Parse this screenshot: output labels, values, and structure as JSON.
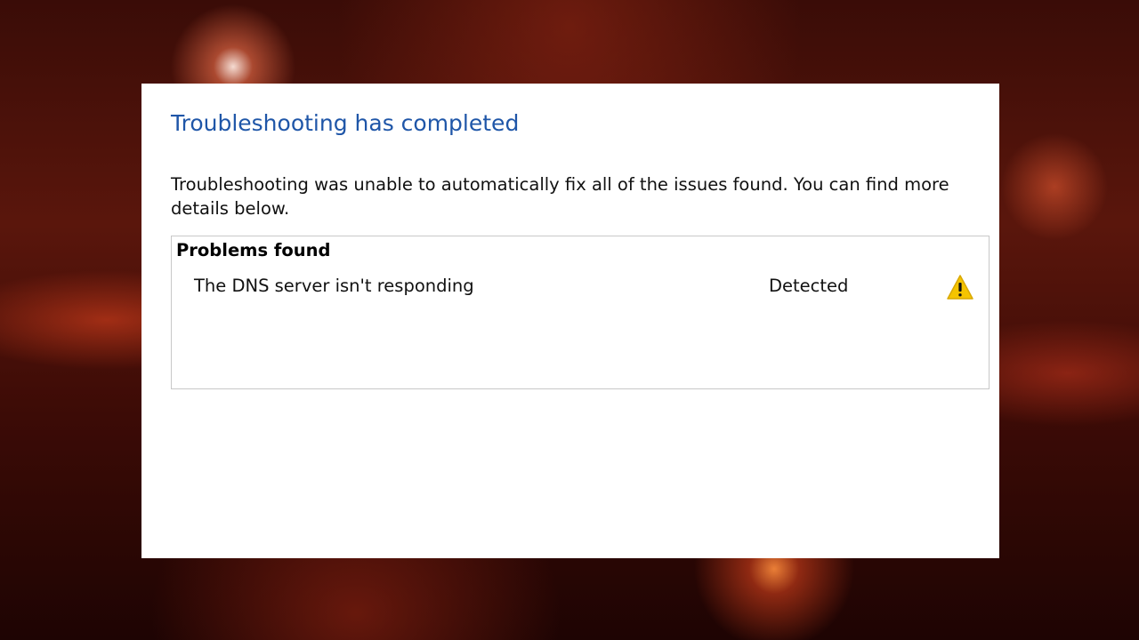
{
  "dialog": {
    "title": "Troubleshooting has completed",
    "description": "Troubleshooting was unable to automatically fix all of the issues found. You can find more details below.",
    "problems_header": "Problems found",
    "problems": [
      {
        "name": "The DNS server isn't responding",
        "status": "Detected",
        "icon": "warning-icon"
      }
    ]
  },
  "colors": {
    "title": "#1f56a8",
    "warning_fill": "#f5c400",
    "box_border": "#c8c8c8"
  }
}
